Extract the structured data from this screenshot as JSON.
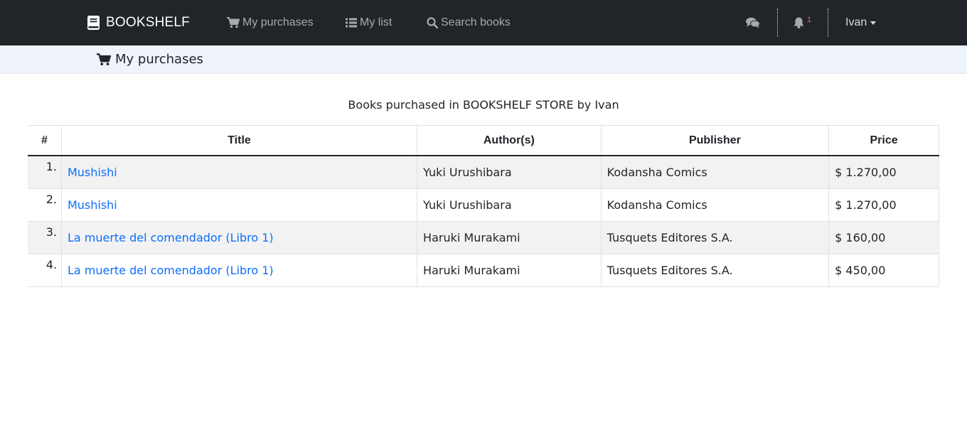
{
  "navbar": {
    "brand": "BOOKSHELF",
    "links": [
      {
        "label": "My purchases",
        "icon": "cart-icon"
      },
      {
        "label": "My list",
        "icon": "list-icon"
      },
      {
        "label": "Search books",
        "icon": "search-icon"
      }
    ],
    "notification_count": "1",
    "user_name": "Ivan"
  },
  "subheader": {
    "title": "My purchases",
    "icon": "cart-icon"
  },
  "caption": "Books purchased in BOOKSHELF STORE by Ivan",
  "table": {
    "headers": [
      "#",
      "Title",
      "Author(s)",
      "Publisher",
      "Price"
    ],
    "rows": [
      {
        "num": "1.",
        "title": "Mushishi",
        "author": "Yuki Urushibara",
        "publisher": "Kodansha Comics",
        "price": "$ 1.270,00"
      },
      {
        "num": "2.",
        "title": "Mushishi",
        "author": "Yuki Urushibara",
        "publisher": "Kodansha Comics",
        "price": "$ 1.270,00"
      },
      {
        "num": "3.",
        "title": "La muerte del comendador (Libro 1)",
        "author": "Haruki Murakami",
        "publisher": "Tusquets Editores S.A.",
        "price": "$ 160,00"
      },
      {
        "num": "4.",
        "title": "La muerte del comendador (Libro 1)",
        "author": "Haruki Murakami",
        "publisher": "Tusquets Editores S.A.",
        "price": "$ 450,00"
      }
    ]
  },
  "colors": {
    "navbar_bg": "#212529",
    "subheader_bg": "#eef3fc",
    "link": "#0d6efd",
    "badge": "#ff5a5f"
  }
}
